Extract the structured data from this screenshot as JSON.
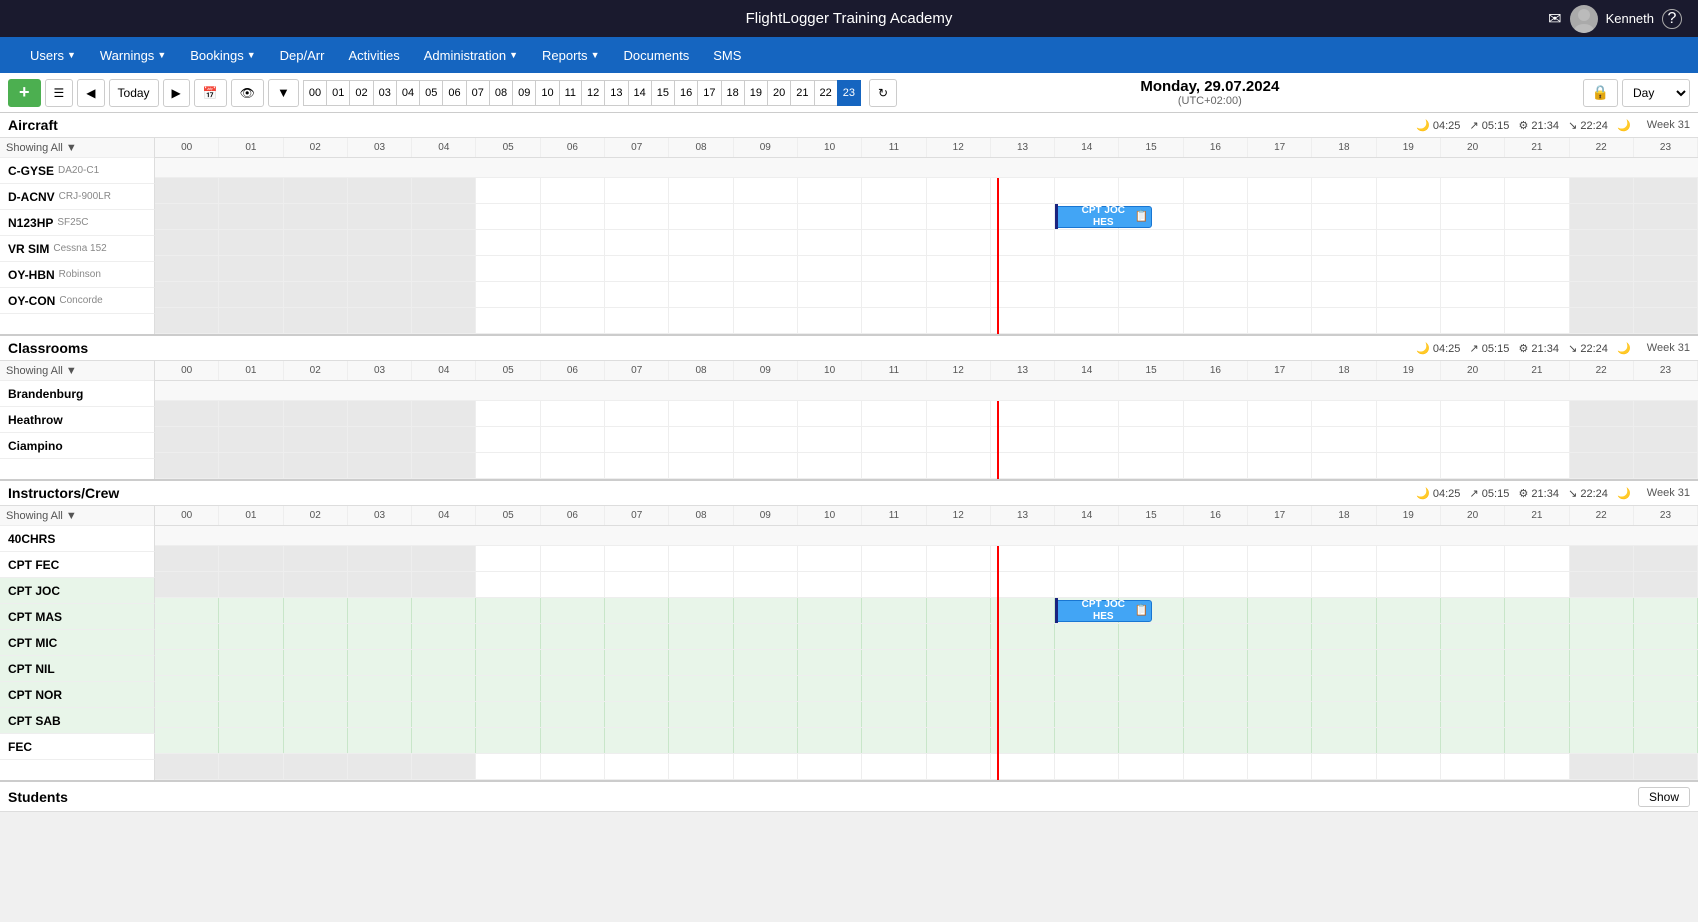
{
  "app": {
    "title": "FlightLogger Training Academy",
    "user": "Kenneth"
  },
  "nav": {
    "items": [
      {
        "label": "Users",
        "hasArrow": true
      },
      {
        "label": "Warnings",
        "hasArrow": true
      },
      {
        "label": "Bookings",
        "hasArrow": true
      },
      {
        "label": "Dep/Arr",
        "hasArrow": false
      },
      {
        "label": "Activities",
        "hasArrow": false
      },
      {
        "label": "Administration",
        "hasArrow": true
      },
      {
        "label": "Reports",
        "hasArrow": true
      },
      {
        "label": "Documents",
        "hasArrow": false
      },
      {
        "label": "SMS",
        "hasArrow": false
      }
    ]
  },
  "toolbar": {
    "add_label": "+",
    "today_label": "Today",
    "date_display": "Monday, 29.07.2024",
    "date_sub": "(UTC+02:00)",
    "day_label": "Day",
    "hours": [
      "00",
      "01",
      "02",
      "03",
      "04",
      "05",
      "06",
      "07",
      "08",
      "09",
      "10",
      "11",
      "12",
      "13",
      "14",
      "15",
      "16",
      "17",
      "18",
      "19",
      "20",
      "21",
      "22",
      "23"
    ],
    "active_hour": "23"
  },
  "sections": {
    "aircraft": {
      "title": "Aircraft",
      "week_label": "Week 31",
      "showing_all": "Showing All",
      "info_bar": "🌙 04:25  ↗ 05:15  ⚙ 21:34  ↘ 22:24  🌙",
      "resources": [
        {
          "name": "C-GYSE",
          "sub": "DA20-C1"
        },
        {
          "name": "D-ACNV",
          "sub": "CRJ-900LR"
        },
        {
          "name": "N123HP",
          "sub": "SF25C"
        },
        {
          "name": "VR SIM",
          "sub": "Cessna 152"
        },
        {
          "name": "OY-HBN",
          "sub": "Robinson"
        },
        {
          "name": "OY-CON",
          "sub": "Concorde"
        }
      ],
      "events": [
        {
          "resource_index": 1,
          "hour_start": 14,
          "hour_end": 15.5,
          "label_line1": "CPT JOC",
          "label_line2": "HES"
        }
      ]
    },
    "classrooms": {
      "title": "Classrooms",
      "week_label": "Week 31",
      "showing_all": "Showing All",
      "info_bar": "🌙 04:25  ↗ 05:15  ⚙ 21:34  ↘ 22:24  🌙",
      "resources": [
        {
          "name": "Brandenburg"
        },
        {
          "name": "Heathrow"
        },
        {
          "name": "Ciampino"
        }
      ]
    },
    "instructors": {
      "title": "Instructors/Crew",
      "week_label": "Week 31",
      "showing_all": "Showing All",
      "info_bar": "🌙 04:25  ↗ 05:15  ⚙ 21:34  ↘ 22:24  🌙",
      "resources": [
        {
          "name": "40CHRS",
          "green": false
        },
        {
          "name": "CPT FEC",
          "green": false
        },
        {
          "name": "CPT JOC",
          "green": true
        },
        {
          "name": "CPT MAS",
          "green": true
        },
        {
          "name": "CPT MIC",
          "green": true
        },
        {
          "name": "CPT NIL",
          "green": true
        },
        {
          "name": "CPT NOR",
          "green": true
        },
        {
          "name": "CPT SAB",
          "green": true
        },
        {
          "name": "FEC",
          "green": false
        }
      ],
      "events": [
        {
          "resource_index": 2,
          "hour_start": 14,
          "hour_end": 15.5,
          "label_line1": "CPT JOC",
          "label_line2": "HES"
        }
      ]
    },
    "students": {
      "title": "Students",
      "show_label": "Show"
    }
  },
  "hours_list": [
    "00",
    "01",
    "02",
    "03",
    "04",
    "05",
    "06",
    "07",
    "08",
    "09",
    "10",
    "11",
    "12",
    "13",
    "14",
    "15",
    "16",
    "17",
    "18",
    "19",
    "20",
    "21",
    "22",
    "23"
  ],
  "current_time_hour": 13.1
}
